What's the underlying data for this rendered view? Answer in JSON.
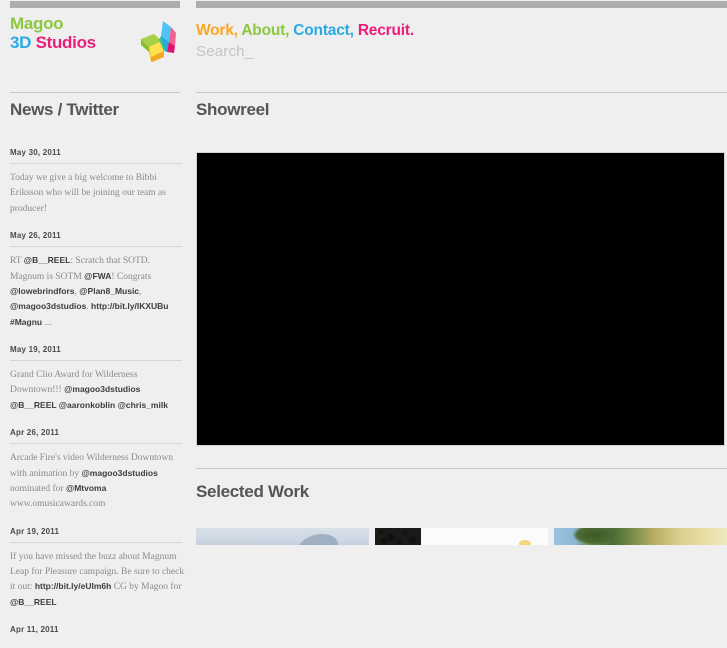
{
  "site": {
    "brand": {
      "line1": "Magoo",
      "line2_part1": "3D",
      "line2_part2": "Studios",
      "logo_icon": "3d-butterfly-logo-icon",
      "colors": {
        "green": "#8dc63f",
        "blue": "#29abe2",
        "pink": "#ec1e79",
        "orange": "#f9a825"
      }
    },
    "nav": {
      "items": [
        {
          "label": "Work",
          "color": "#f9a825",
          "separator": ","
        },
        {
          "label": "About",
          "color": "#8dc63f",
          "separator": ","
        },
        {
          "label": "Contact",
          "color": "#29abe2",
          "separator": ","
        },
        {
          "label": "Recruit",
          "color": "#ec1e79",
          "separator": "."
        }
      ]
    },
    "search": {
      "placeholder": "Search_",
      "value": ""
    }
  },
  "sidebar": {
    "title": "News / Twitter",
    "news": [
      {
        "date": "May 30, 2011",
        "text": "Today we give a big welcome to Bibbi Eriksson who will be joining our team as producer!"
      },
      {
        "date": "May 26, 2011",
        "text": "RT @B__REEL: Scratch that SOTD. Magnum is SOTM @FWA! Congrats @lowebrindfors, @Plan8_Music, @magoo3dstudios. http://bit.ly/lKXUBu #Magnu ..."
      },
      {
        "date": "May 19, 2011",
        "text": "Grand Clio Award for Wilderness Downtown!!! @magoo3dstudios @B__REEL @aaronkoblin @chris_milk"
      },
      {
        "date": "Apr 26, 2011",
        "text": "Arcade Fire's video Wilderness Downtown with animation by @magoo3dstudios nominated for @Mtvoma www.omusicawards.com"
      },
      {
        "date": "Apr 19, 2011",
        "text": "If you have missed the buzz about Magnum Leap for Pleasure campaign. Be sure to check it out: http://bit.ly/eUIm6h CG by Magoo for @B__REEL"
      },
      {
        "date": "Apr 11, 2011",
        "text": ""
      }
    ]
  },
  "main": {
    "showreel": {
      "title": "Showreel",
      "player_state": "stopped"
    },
    "selected_work": {
      "title": "Selected Work",
      "thumbnails": [
        {
          "name": "thumbnail-1"
        },
        {
          "name": "thumbnail-2"
        },
        {
          "name": "thumbnail-3"
        }
      ]
    }
  }
}
